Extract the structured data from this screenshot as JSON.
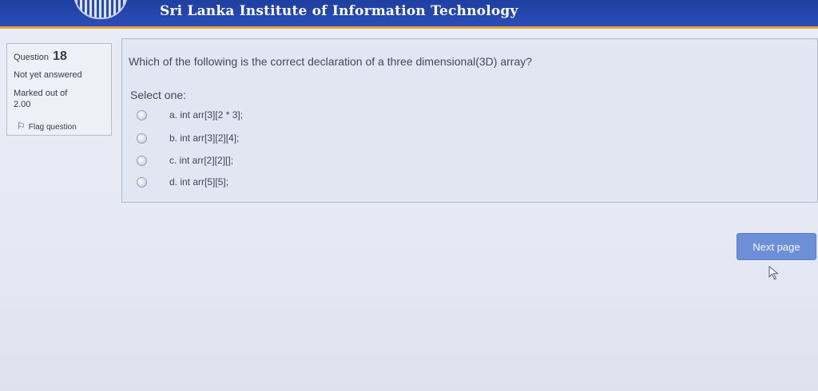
{
  "header": {
    "site_title": "Sri Lanka Institute of Information Technology",
    "logo_icon": "sliit-logo-icon",
    "bar_color": "#2a4db8",
    "accent_color": "#e4a23a"
  },
  "question_info": {
    "question_prefix": "Question",
    "question_number": "18",
    "state": "Not yet answered",
    "marked_out_of_label": "Marked out of",
    "marked_out_of_value": "2.00",
    "flag_label": "Flag question",
    "flag_icon": "flag-icon"
  },
  "question": {
    "text": "Which of the following is the correct declaration of a three dimensional(3D) array?",
    "prompt": "Select one:",
    "answers": [
      {
        "label": "a. int arr[3][2 * 3];",
        "selected": false
      },
      {
        "label": "b. int arr[3][2][4];",
        "selected": false
      },
      {
        "label": "c. int arr[2][2][];",
        "selected": false
      },
      {
        "label": "d. int arr[5][5];",
        "selected": false
      }
    ]
  },
  "navigation": {
    "next_label": "Next page",
    "button_color": "#6c8fd8"
  }
}
